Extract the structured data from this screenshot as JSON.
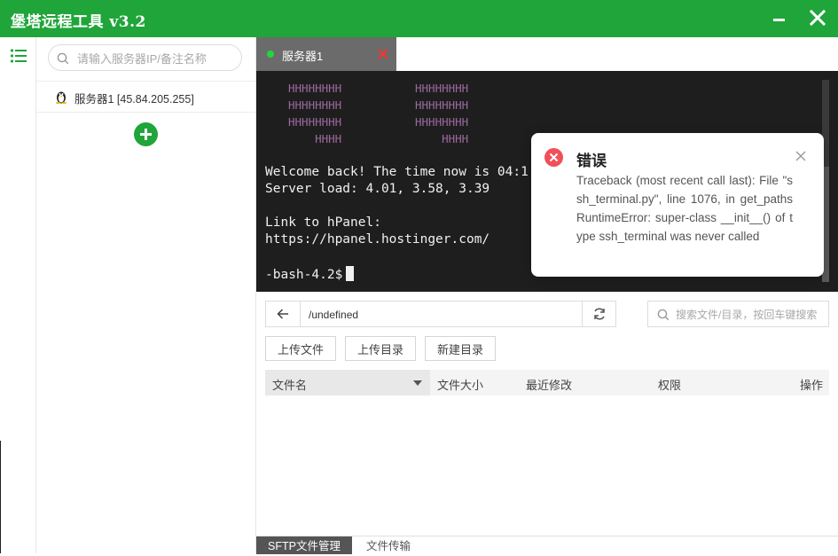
{
  "app": {
    "title": "堡塔远程工具 v3.2"
  },
  "sidebar": {
    "search_placeholder": "请输入服务器IP/备注名称",
    "servers": [
      {
        "label": "服务器1 [45.84.205.255]",
        "os_icon": "linux-tux-icon"
      }
    ]
  },
  "tabs": [
    {
      "label": "服务器1",
      "status_color": "#20d83c"
    }
  ],
  "terminal": {
    "logo_lines": [
      "HHHHHHHH           HHHHHHHH",
      "HHHHHHHH           HHHHHHHH",
      "HHHHHHHH           HHHHHHHH",
      "    HHHH               HHHH"
    ],
    "lines": [
      "Welcome back! The time now is 04:1",
      "Server load: 4.01, 3.58, 3.39",
      "",
      "Link to hPanel:",
      "https://hpanel.hostinger.com/",
      "",
      "-bash-4.2$"
    ]
  },
  "error_toast": {
    "title": "错误",
    "message": "Traceback (most recent call last): File \"ssh_terminal.py\", line 1076, in get_paths RuntimeError: super-class __init__() of type ssh_terminal was never called"
  },
  "file_manager": {
    "path": "/undefined",
    "search_placeholder": "搜索文件/目录，按回车键搜索",
    "buttons": {
      "upload_file": "上传文件",
      "upload_dir": "上传目录",
      "new_dir": "新建目录"
    },
    "columns": {
      "name": "文件名",
      "size": "文件大小",
      "modified": "最近修改",
      "permissions": "权限",
      "actions": "操作"
    }
  },
  "bottom_tabs": {
    "sftp": "SFTP文件管理",
    "transfer": "文件传输"
  },
  "colors": {
    "brand": "#20a53a",
    "terminal_bg": "#1e1e1e",
    "error": "#f0505a",
    "logo_text": "#9b6aa0"
  }
}
